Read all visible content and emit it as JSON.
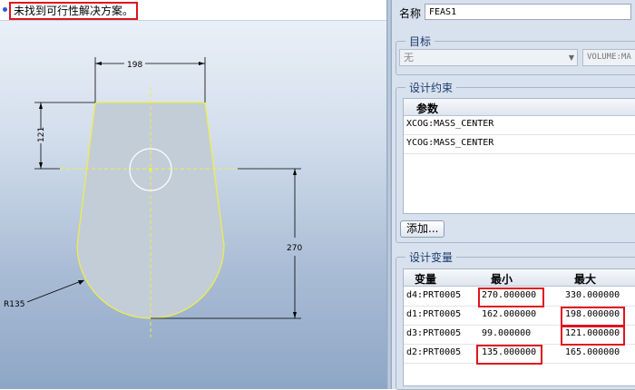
{
  "status": {
    "message": "未找到可行性解决方案。"
  },
  "drawing": {
    "dim_top_width": "198",
    "dim_height_top": "121",
    "dim_height_lower": "270",
    "dim_radius": "R135"
  },
  "panel": {
    "name_label": "名称",
    "name_value": "FEAS1",
    "objective": {
      "title": "目标",
      "select_value": "无",
      "select2_value": "VOLUME:MA"
    },
    "constraints": {
      "title": "设计约束",
      "header": "参数",
      "rows": [
        "XCOG:MASS_CENTER",
        "YCOG:MASS_CENTER"
      ],
      "add_button": "添加..."
    },
    "variables": {
      "title": "设计变量",
      "headers": [
        "变量",
        "最小",
        "最大"
      ],
      "rows": [
        {
          "var": "d4:PRT0005",
          "min": "270.000000",
          "max": "330.000000"
        },
        {
          "var": "d1:PRT0005",
          "min": "162.000000",
          "max": "198.000000"
        },
        {
          "var": "d3:PRT0005",
          "min": "99.000000",
          "max": "121.000000"
        },
        {
          "var": "d2:PRT0005",
          "min": "135.000000",
          "max": "165.000000"
        }
      ]
    }
  },
  "colors": {
    "highlight": "#e0141e",
    "sketch": "#e8e82a"
  }
}
